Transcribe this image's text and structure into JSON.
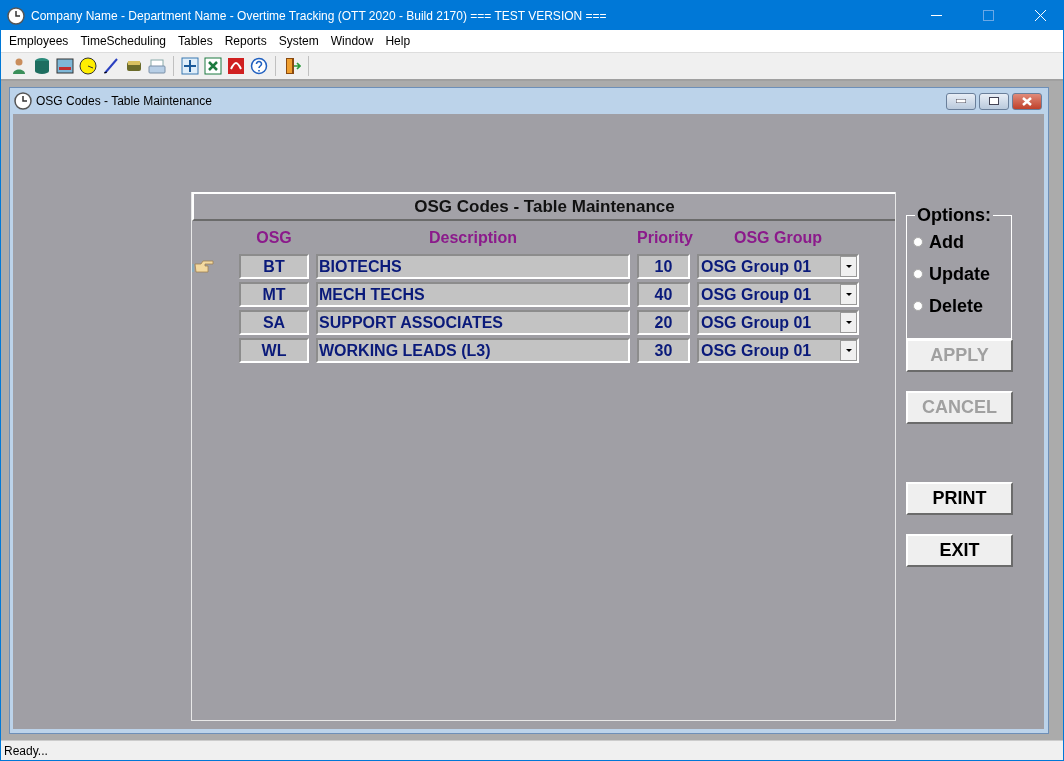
{
  "window": {
    "title": "Company Name - Department Name - Overtime Tracking (OTT 2020 - Build 2170)  === TEST VERSION ==="
  },
  "menu": [
    "Employees",
    "TimeScheduling",
    "Tables",
    "Reports",
    "System",
    "Window",
    "Help"
  ],
  "child_window": {
    "title": "OSG Codes - Table Maintenance"
  },
  "panel": {
    "title": "OSG Codes - Table Maintenance",
    "columns": [
      "OSG",
      "Description",
      "Priority",
      "OSG Group"
    ],
    "rows": [
      {
        "osg": "BT",
        "description": "BIOTECHS",
        "priority": "10",
        "group": "OSG Group 01",
        "selected": true
      },
      {
        "osg": "MT",
        "description": "MECH TECHS",
        "priority": "40",
        "group": "OSG Group 01",
        "selected": false
      },
      {
        "osg": "SA",
        "description": "SUPPORT ASSOCIATES",
        "priority": "20",
        "group": "OSG Group 01",
        "selected": false
      },
      {
        "osg": "WL",
        "description": "WORKING LEADS (L3)",
        "priority": "30",
        "group": "OSG Group 01",
        "selected": false
      }
    ]
  },
  "options": {
    "legend": "Options:",
    "items": [
      {
        "label": "Add",
        "selected": false
      },
      {
        "label": "Update",
        "selected": false
      },
      {
        "label": "Delete",
        "selected": false
      }
    ]
  },
  "buttons": [
    {
      "label": "APPLY",
      "disabled": true
    },
    {
      "label": "CANCEL",
      "disabled": true
    },
    {
      "label": "PRINT",
      "disabled": false
    },
    {
      "label": "EXIT",
      "disabled": false
    }
  ],
  "status_bar": "Ready..."
}
